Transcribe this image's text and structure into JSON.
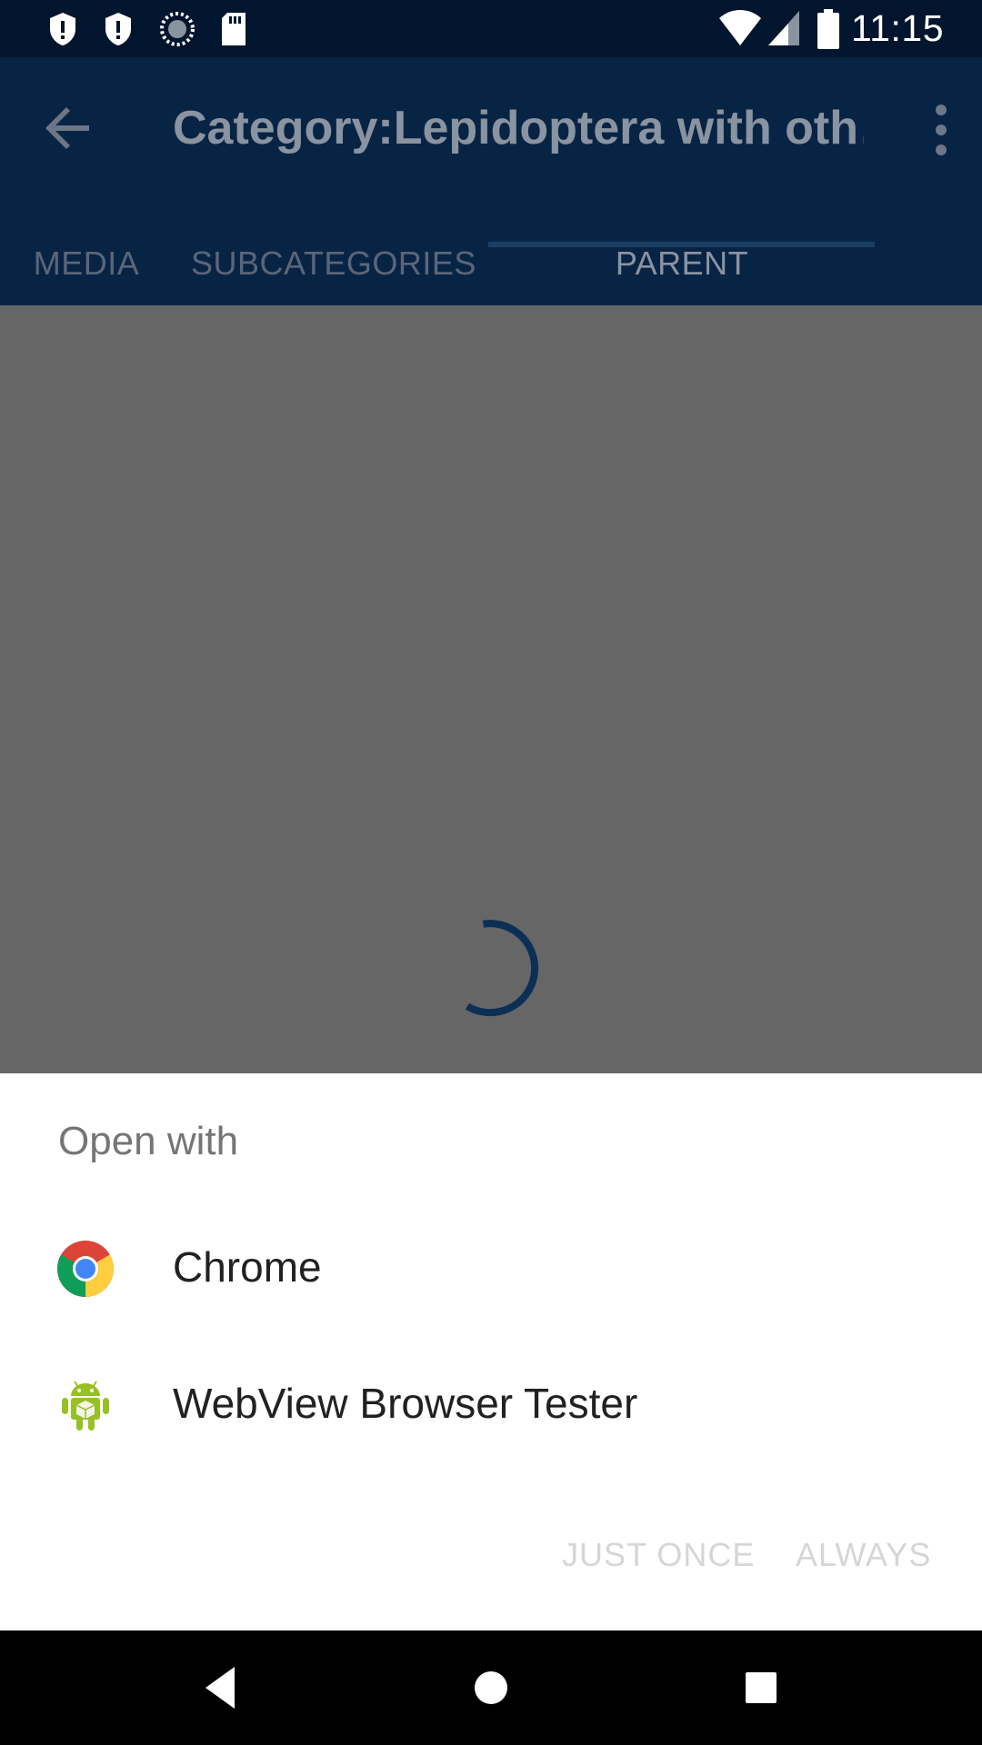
{
  "status_bar": {
    "time": "11:15",
    "icons": [
      "shield-alert-icon",
      "shield-alert-icon",
      "sync-progress-icon",
      "sd-card-icon",
      "wifi-icon",
      "signal-icon",
      "battery-icon"
    ]
  },
  "app_bar": {
    "title": "Category:Lepidoptera with oth…",
    "back_icon": "arrow-back-icon",
    "overflow_icon": "more-vert-icon"
  },
  "tabs": [
    {
      "label": "MEDIA",
      "active": false
    },
    {
      "label": "SUBCATEGORIES",
      "active": false
    },
    {
      "label": "PARENT CATEGORIES",
      "active": true
    }
  ],
  "sheet": {
    "title": "Open with",
    "apps": [
      {
        "label": "Chrome",
        "icon": "chrome-icon"
      },
      {
        "label": "WebView Browser Tester",
        "icon": "android-icon"
      }
    ],
    "actions": {
      "just_once": "JUST ONCE",
      "always": "ALWAYS"
    }
  },
  "colors": {
    "status_bar_bg": "#02152e",
    "app_bar_bg": "#082445",
    "scrim": "#666666",
    "sheet_bg": "#ffffff",
    "spinner": "#0b2f55"
  }
}
